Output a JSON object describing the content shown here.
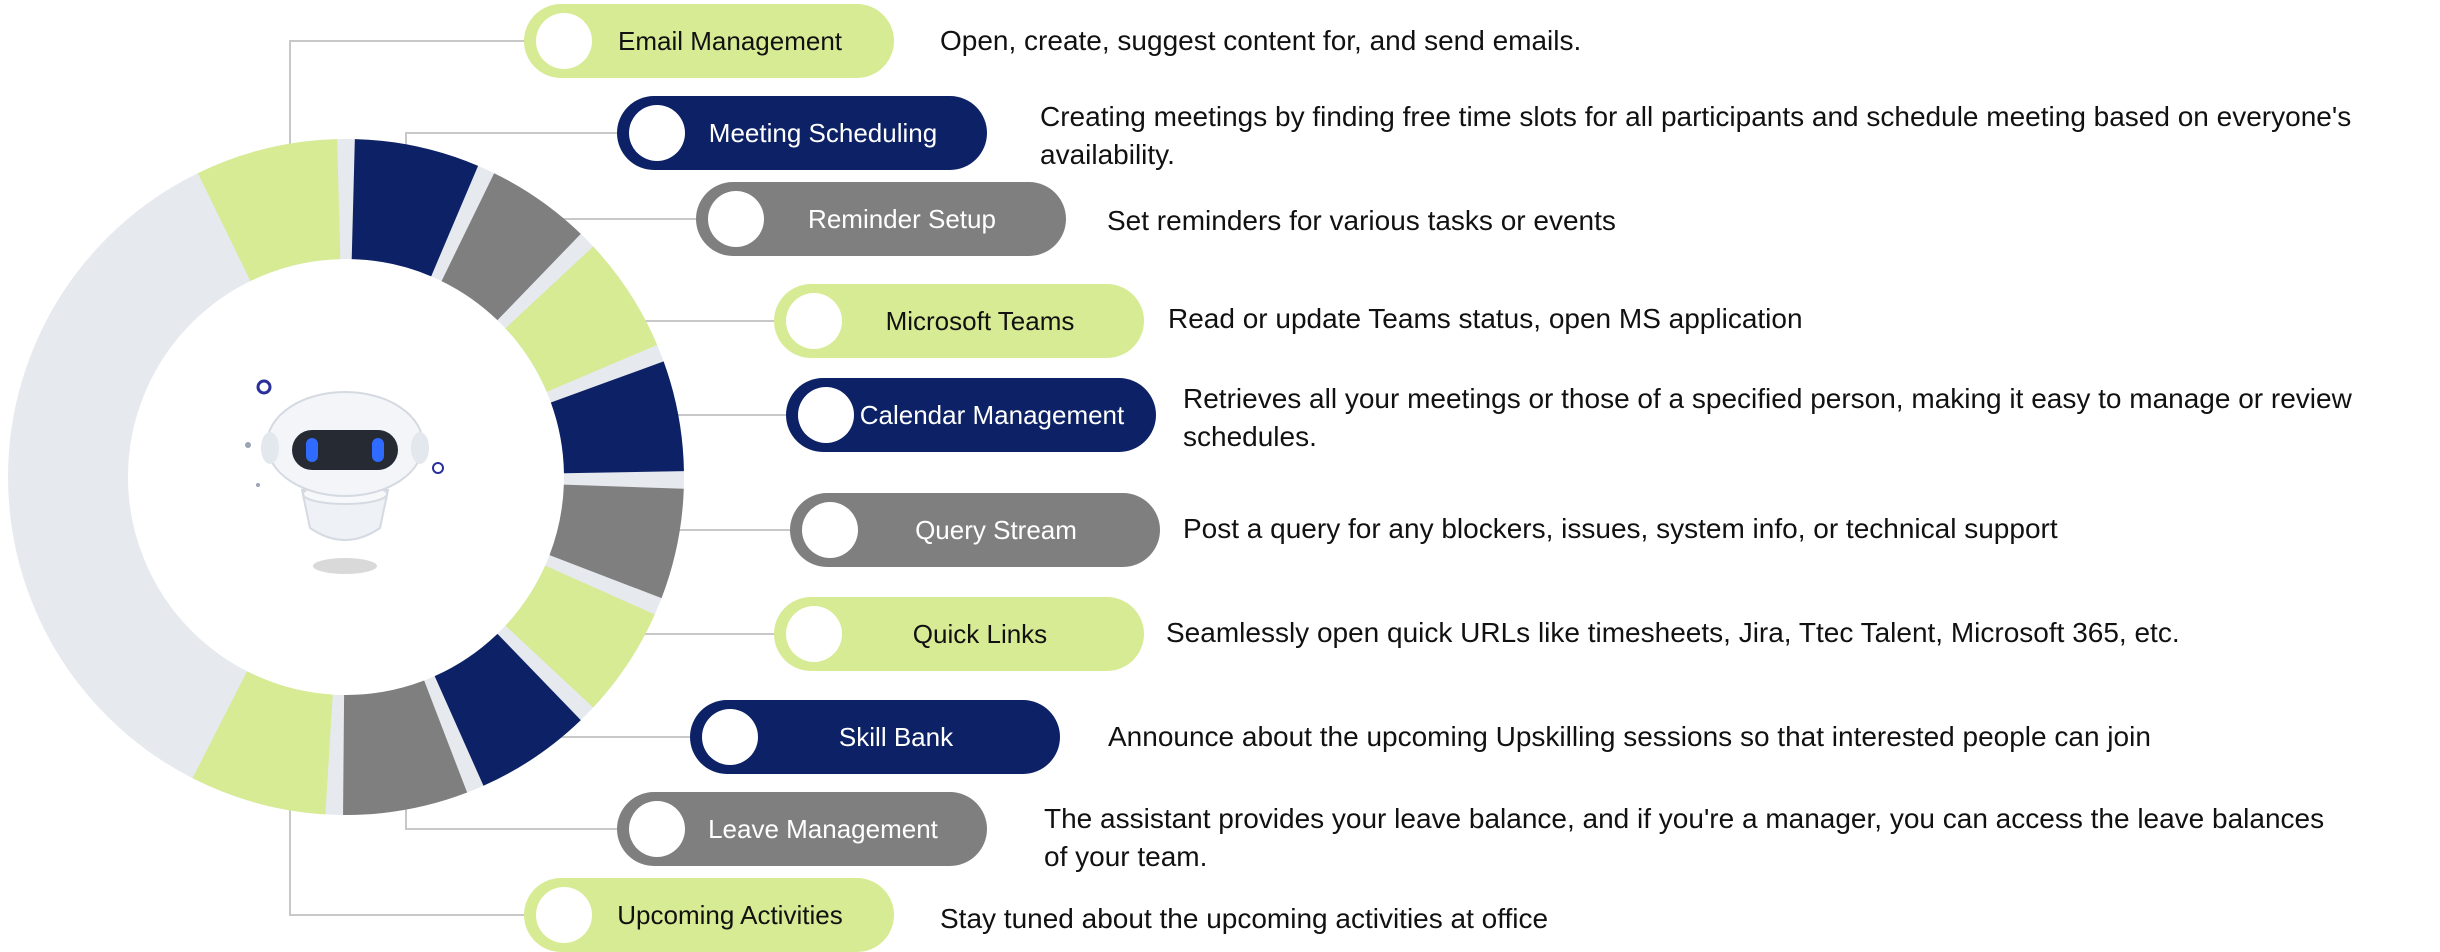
{
  "features": [
    {
      "label": "Email Management",
      "description": "Open, create, suggest content for, and send emails.",
      "theme": "green"
    },
    {
      "label": "Meeting Scheduling",
      "description": "Creating meetings by finding free time slots for all participants and schedule meeting based on everyone's availability.",
      "theme": "navy"
    },
    {
      "label": "Reminder Setup",
      "description": "Set reminders for various tasks or events",
      "theme": "gray"
    },
    {
      "label": "Microsoft Teams",
      "description": "Read or update Teams status, open MS application",
      "theme": "green"
    },
    {
      "label": "Calendar Management",
      "description": "Retrieves all your meetings or those of a specified person, making it easy to manage or review schedules.",
      "theme": "navy"
    },
    {
      "label": "Query Stream",
      "description": "Post a query for any blockers, issues, system info, or technical support",
      "theme": "gray"
    },
    {
      "label": "Quick Links",
      "description": "Seamlessly open quick URLs like timesheets, Jira, Ttec Talent, Microsoft 365, etc.",
      "theme": "green"
    },
    {
      "label": "Skill Bank",
      "description": "Announce about the upcoming Upskilling sessions so that interested people can join",
      "theme": "navy"
    },
    {
      "label": "Leave Management",
      "description": "The assistant provides your leave balance, and if you're a manager, you can access the leave balances of your team.",
      "theme": "gray"
    },
    {
      "label": "Upcoming Activities",
      "description": "Stay tuned about the upcoming activities at office",
      "theme": "green"
    }
  ],
  "colors": {
    "green": "#d6eb93",
    "navy": "#0d2266",
    "gray": "#7f7f7f",
    "ring_background": "#e6e9ee",
    "connector": "#c8c8c8"
  }
}
